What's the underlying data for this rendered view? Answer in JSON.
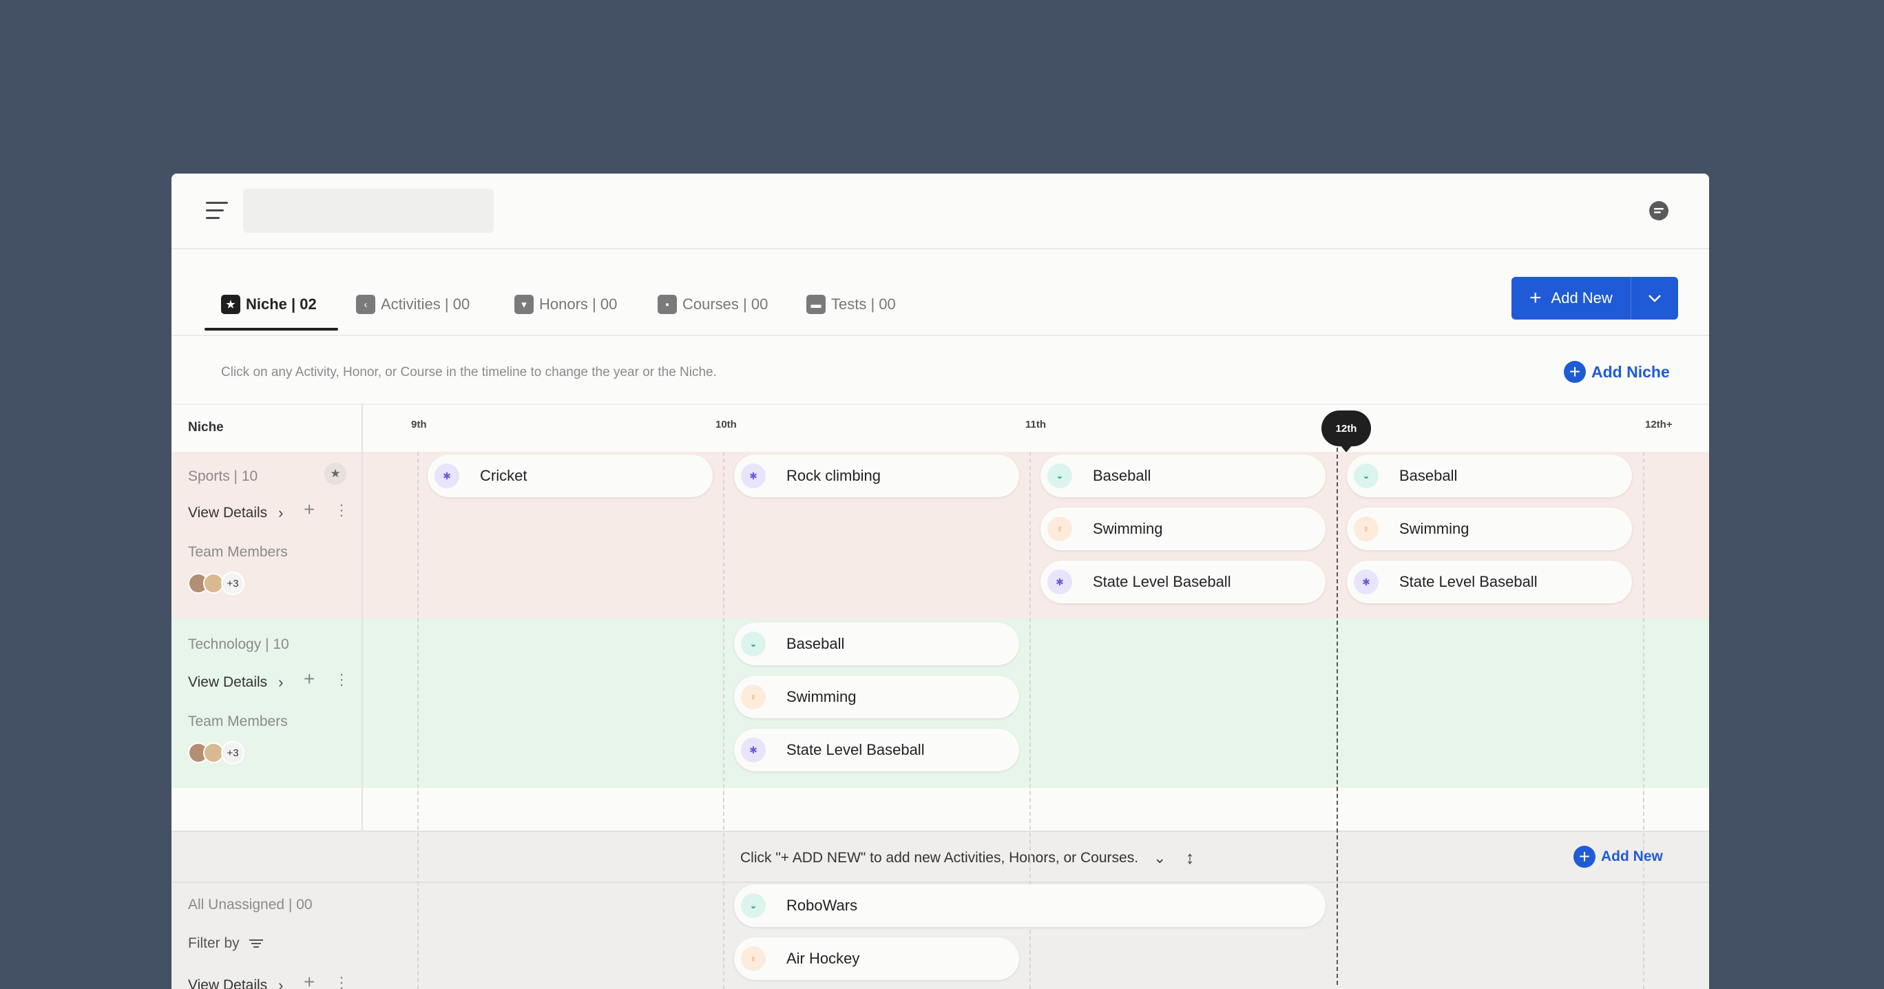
{
  "tabs": [
    {
      "label": "Niche | 02",
      "icon": "star-icon"
    },
    {
      "label": "Activities | 00",
      "icon": "activities-icon"
    },
    {
      "label": "Honors | 00",
      "icon": "honors-icon"
    },
    {
      "label": "Courses | 00",
      "icon": "courses-icon"
    },
    {
      "label": "Tests | 00",
      "icon": "tests-icon"
    }
  ],
  "add_new_button": {
    "label": "Add New"
  },
  "hint": "Click on any Activity, Honor, or Course in the timeline to change the year or the Niche.",
  "add_niche_label": "Add Niche",
  "timeline": {
    "niche_column_label": "Niche",
    "grades": [
      "9th",
      "10th",
      "11th",
      "12th",
      "12th+"
    ],
    "current_grade": "12th"
  },
  "niches": [
    {
      "title": "Sports | 10",
      "view_details": "View Details",
      "team_label": "Team Members",
      "team_more": "+3",
      "chips": [
        [
          "Cricket",
          "Rock climbing",
          "Baseball",
          "Swimming",
          "State Level Baseball",
          "Baseball",
          "Swimming",
          "State Level Baseball"
        ]
      ]
    },
    {
      "title": "Technology | 10",
      "view_details": "View Details",
      "team_label": "Team Members",
      "team_more": "+3",
      "chips": [
        "Baseball",
        "Swimming",
        "State Level Baseball"
      ]
    }
  ],
  "sports_chips": [
    {
      "label": "Cricket",
      "icon": "purple"
    },
    {
      "label": "Rock climbing",
      "icon": "purple"
    },
    {
      "label": "Baseball",
      "icon": "teal"
    },
    {
      "label": "Swimming",
      "icon": "orange"
    },
    {
      "label": "State Level Baseball",
      "icon": "purple"
    },
    {
      "label": "Baseball",
      "icon": "teal"
    },
    {
      "label": "Swimming",
      "icon": "orange"
    },
    {
      "label": "State Level Baseball",
      "icon": "purple"
    }
  ],
  "tech_chips": [
    {
      "label": "Baseball",
      "icon": "teal"
    },
    {
      "label": "Swimming",
      "icon": "orange"
    },
    {
      "label": "State Level Baseball",
      "icon": "purple"
    }
  ],
  "bottom_bar": {
    "text": "Click \"+ ADD NEW\" to add new Activities, Honors, or Courses.",
    "add_new": "Add New"
  },
  "unassigned": {
    "title": "All Unassigned | 00",
    "filter_by": "Filter by",
    "view_details": "View Details",
    "chips": [
      {
        "label": "RoboWars",
        "icon": "teal"
      },
      {
        "label": "Air Hockey",
        "icon": "orange"
      }
    ]
  },
  "colors": {
    "accent": "#1f5bd6",
    "sports_band": "#f7ebe7",
    "tech_band": "#e8f5ea",
    "background": "#445063"
  }
}
